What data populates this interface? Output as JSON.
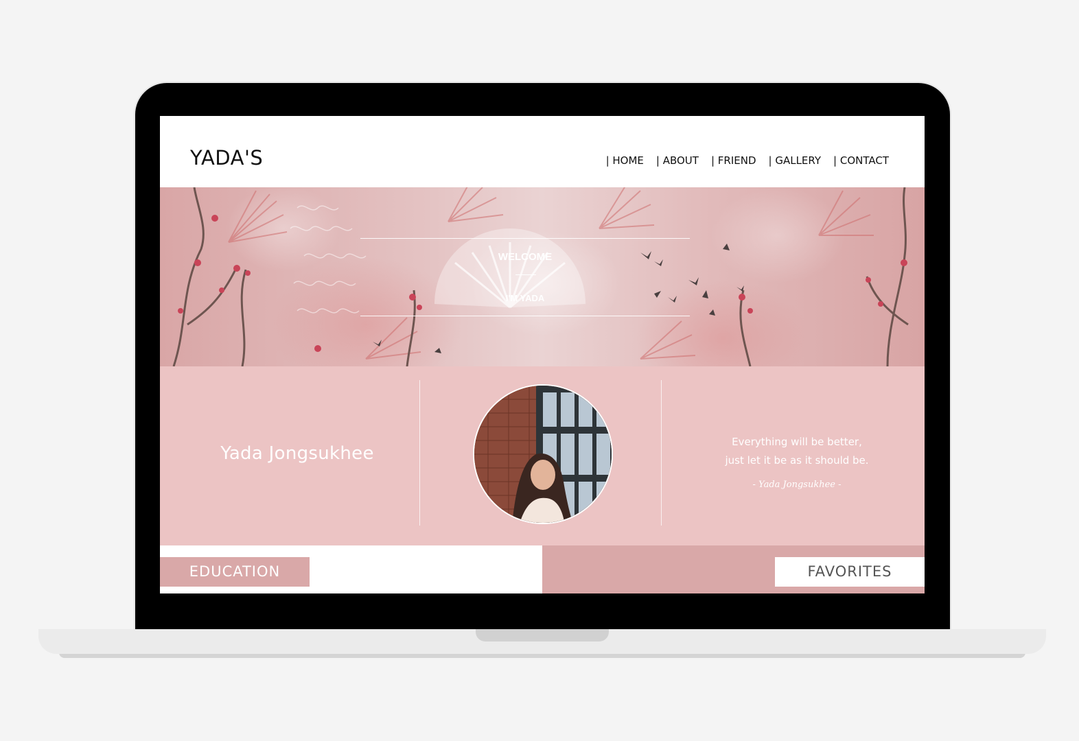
{
  "site": {
    "logo": "YADA'S",
    "nav": [
      "| HOME",
      "| ABOUT",
      "| FRIEND",
      "| GALLERY",
      "| CONTACT"
    ]
  },
  "hero": {
    "welcome": "WELCOME",
    "subtitle": "I'M YADA"
  },
  "profile": {
    "name": "Yada Jongsukhee",
    "quote_line1": "Everything will be better,",
    "quote_line2": "just let it be as it should be.",
    "quote_author": "- Yada Jongsukhee -"
  },
  "sections": {
    "education": "EDUCATION",
    "favorites": "FAVORITES"
  },
  "colors": {
    "page_bg": "#f4f4f4",
    "pink_band": "#ecc4c4",
    "rose_accent": "#d9a8a8",
    "frame": "#000000"
  }
}
